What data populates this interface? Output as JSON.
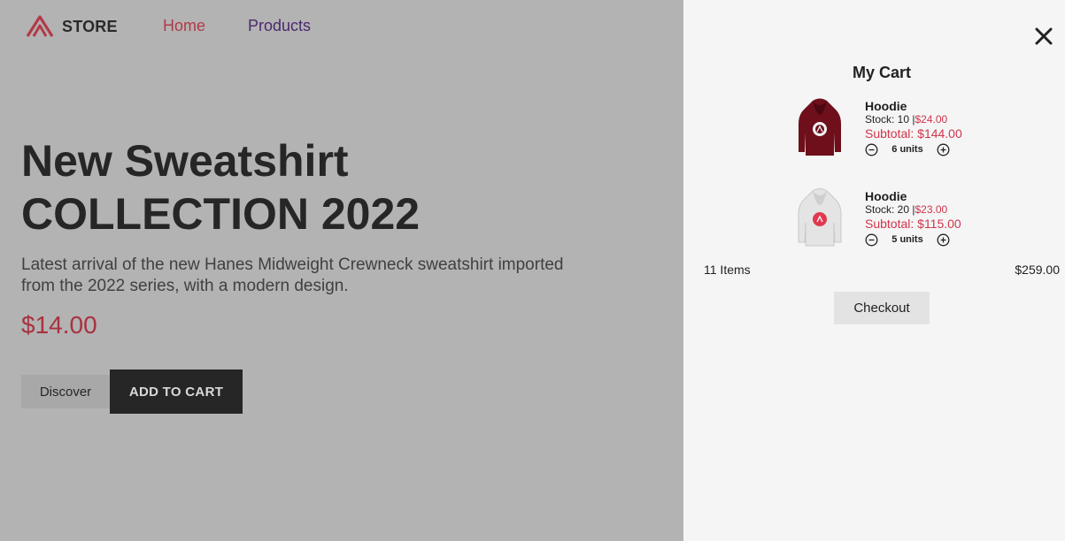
{
  "colors": {
    "accent": "#b23a48",
    "price_red": "#d0354b",
    "overlay": "#b3b3b3",
    "drawer": "#f5f5f5",
    "dark": "#262626"
  },
  "nav": {
    "brand": "STORE",
    "logo_icon": "triangle-a-logo",
    "links": [
      {
        "label": "Home"
      },
      {
        "label": "Products"
      }
    ]
  },
  "hero": {
    "title_line1": "New Sweatshirt",
    "title_line2": "COLLECTION 2022",
    "description": "Latest arrival of the new Hanes Midweight Crewneck sweatshirt imported from the 2022 series, with a modern design.",
    "price": "$14.00",
    "discover_label": "Discover",
    "add_to_cart_label": "ADD TO CART"
  },
  "cart": {
    "title": "My Cart",
    "close_icon": "close-icon",
    "items": [
      {
        "name": "Hoodie",
        "stock_label": "Stock: 10 |",
        "unit_price": "$24.00",
        "subtotal": "Subtotal: $144.00",
        "quantity": "6 units",
        "color": "burgundy"
      },
      {
        "name": "Hoodie",
        "stock_label": "Stock: 20 |",
        "unit_price": "$23.00",
        "subtotal": "Subtotal: $115.00",
        "quantity": "5 units",
        "color": "light-gray"
      }
    ],
    "item_count": "11 Items",
    "total": "$259.00",
    "checkout_label": "Checkout"
  }
}
